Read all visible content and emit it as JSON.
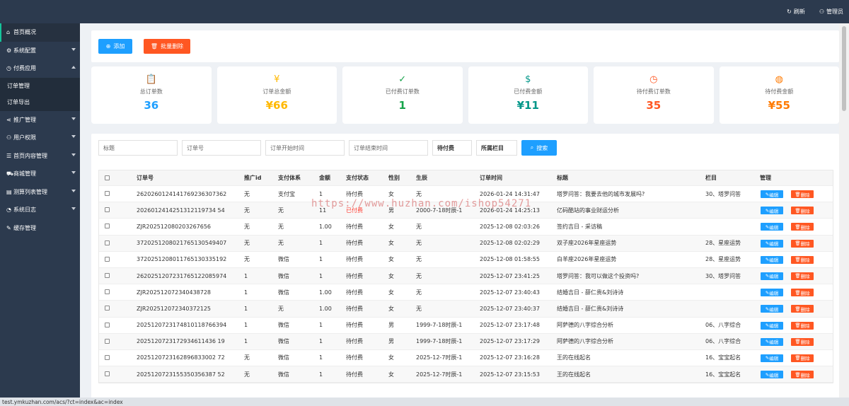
{
  "topbar": {
    "refresh": "刷新",
    "admin": "管理员"
  },
  "sidebar": {
    "items": [
      {
        "label": "首页概况",
        "icon": "home-icon",
        "sub": []
      },
      {
        "label": "系统配置",
        "icon": "gear-icon",
        "sub": []
      },
      {
        "label": "付费应用",
        "icon": "clock-icon",
        "sub": [
          "订单管理",
          "订单导出"
        ]
      },
      {
        "label": "推广管理",
        "icon": "share-icon",
        "sub": []
      },
      {
        "label": "用户权限",
        "icon": "user-icon",
        "sub": []
      },
      {
        "label": "首页内容管理",
        "icon": "list-icon",
        "sub": []
      },
      {
        "label": "商城管理",
        "icon": "cart-icon",
        "sub": []
      },
      {
        "label": "测算列表管理",
        "icon": "chart-icon",
        "sub": []
      },
      {
        "label": "系统日志",
        "icon": "log-icon",
        "sub": []
      },
      {
        "label": "缓存管理",
        "icon": "wrench-icon",
        "sub": []
      }
    ]
  },
  "actions": {
    "add": "添加",
    "batch_delete": "批量删除"
  },
  "stats": [
    {
      "label": "总订单数",
      "value": "36",
      "color": "#1e9fff",
      "icon": "clipboard-icon",
      "glyph": "📋"
    },
    {
      "label": "订单总金额",
      "value": "¥66",
      "color": "#ffb800",
      "icon": "yen-icon",
      "glyph": "¥"
    },
    {
      "label": "已付费订单数",
      "value": "1",
      "color": "#16a34a",
      "icon": "check-circle-icon",
      "glyph": "✓"
    },
    {
      "label": "已付费金额",
      "value": "¥11",
      "color": "#009688",
      "icon": "dollar-icon",
      "glyph": "$"
    },
    {
      "label": "待付费订单数",
      "value": "35",
      "color": "#ff5722",
      "icon": "clock-icon",
      "glyph": "◷"
    },
    {
      "label": "待付费金额",
      "value": "¥55",
      "color": "#ff7a00",
      "icon": "globe-icon",
      "glyph": "◍"
    }
  ],
  "filters": {
    "title": "标题",
    "order_no": "订单号",
    "start_time": "订单开始时间",
    "end_time": "订单结束时间",
    "status": "待付费",
    "column": "所属栏目",
    "search": "搜索"
  },
  "table": {
    "headers": [
      "订单号",
      "推广id",
      "支付体系",
      "金额",
      "支付状态",
      "性别",
      "生辰",
      "订单时间",
      "标题",
      "栏目",
      "管理"
    ],
    "edit": "编辑",
    "delete": "删除",
    "rows": [
      [
        "2620260124141769236307362",
        "无",
        "支付宝",
        "1",
        "待付费",
        "女",
        "无",
        "2026-01-24 14:31:47",
        "塔罗问答：我要去他的城市发展吗?",
        "30、塔罗问答"
      ],
      [
        "2026012414251312119734 54",
        "无",
        "无",
        "11",
        "已付费",
        "男",
        "2000-7-18时辰-1",
        "2026-01-24 14:25:13",
        "亿码酷站的事业财运分析",
        ""
      ],
      [
        "ZJR202512080203267656",
        "无",
        "无",
        "1.00",
        "待付费",
        "女",
        "无",
        "2025-12-08 02:03:26",
        "签约吉日 - 采访稿",
        ""
      ],
      [
        "3720251208021765130549407",
        "无",
        "无",
        "1",
        "待付费",
        "女",
        "无",
        "2025-12-08 02:02:29",
        "双子座2026年星座运势",
        "28、星座运势"
      ],
      [
        "3720251208011765130335192",
        "无",
        "微信",
        "1",
        "待付费",
        "女",
        "无",
        "2025-12-08 01:58:55",
        "白羊座2026年星座运势",
        "28、星座运势"
      ],
      [
        "2620251207231765122085974",
        "1",
        "微信",
        "1",
        "待付费",
        "女",
        "无",
        "2025-12-07 23:41:25",
        "塔罗问答：我可以做这个投资吗?",
        "30、塔罗问答"
      ],
      [
        "ZJR202512072340438728",
        "1",
        "微信",
        "1.00",
        "待付费",
        "女",
        "无",
        "2025-12-07 23:40:43",
        "结婚吉日 - 薛仁贵&刘诗诗",
        ""
      ],
      [
        "ZJR202512072340372125",
        "1",
        "无",
        "1.00",
        "待付费",
        "女",
        "无",
        "2025-12-07 23:40:37",
        "结婚吉日 - 薛仁贵&刘诗诗",
        ""
      ],
      [
        "2025120723174810118766394",
        "1",
        "微信",
        "1",
        "待付费",
        "男",
        "1999-7-18时辰-1",
        "2025-12-07 23:17:48",
        "阿萨德的八字综合分析",
        "06、八字综合"
      ],
      [
        "2025120723172934611436 19",
        "1",
        "微信",
        "1",
        "待付费",
        "男",
        "1999-7-18时辰-1",
        "2025-12-07 23:17:29",
        "阿萨德的八字综合分析",
        "06、八字综合"
      ],
      [
        "2025120723162896833002 72",
        "无",
        "微信",
        "1",
        "待付费",
        "女",
        "2025-12-7时辰-1",
        "2025-12-07 23:16:28",
        "王的在线起名",
        "16、宝宝起名"
      ],
      [
        "2025120723155350356387 52",
        "无",
        "微信",
        "1",
        "待付费",
        "女",
        "2025-12-7时辰-1",
        "2025-12-07 23:15:53",
        "王的在线起名",
        "16、宝宝起名"
      ]
    ]
  },
  "watermark": "https://www.huzhan.com/ishop54271",
  "statusbar": "test.ymkuzhan.com/acs/?ct=index&ac=index",
  "colors": {
    "sidebar": "#2c3a4e",
    "accent": "#15c39a",
    "blue": "#1e9fff",
    "orange": "#ff5722"
  }
}
